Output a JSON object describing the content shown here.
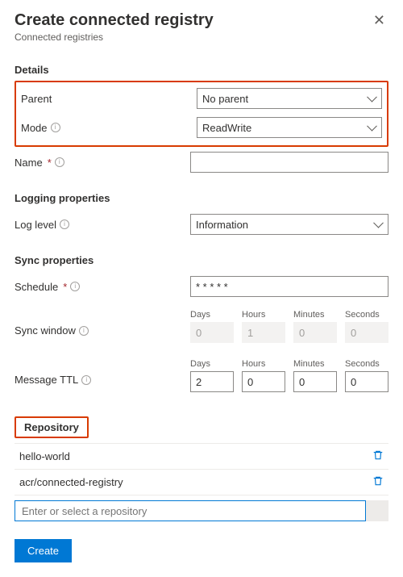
{
  "header": {
    "title": "Create connected registry",
    "subtitle": "Connected registries"
  },
  "sections": {
    "details": "Details",
    "logging": "Logging properties",
    "sync": "Sync properties",
    "repository": "Repository"
  },
  "labels": {
    "parent": "Parent",
    "mode": "Mode",
    "name": "Name",
    "logLevel": "Log level",
    "schedule": "Schedule",
    "syncWindow": "Sync window",
    "messageTtl": "Message TTL",
    "days": "Days",
    "hours": "Hours",
    "minutes": "Minutes",
    "seconds": "Seconds"
  },
  "values": {
    "parent": "No parent",
    "mode": "ReadWrite",
    "name": "",
    "logLevel": "Information",
    "schedule": "* * * * *",
    "syncWindow": {
      "days": "0",
      "hours": "1",
      "minutes": "0",
      "seconds": "0"
    },
    "messageTtl": {
      "days": "2",
      "hours": "0",
      "minutes": "0",
      "seconds": "0"
    },
    "repoAddPlaceholder": "Enter or select a repository"
  },
  "repositories": [
    {
      "name": "hello-world"
    },
    {
      "name": "acr/connected-registry"
    }
  ],
  "footer": {
    "create": "Create"
  }
}
